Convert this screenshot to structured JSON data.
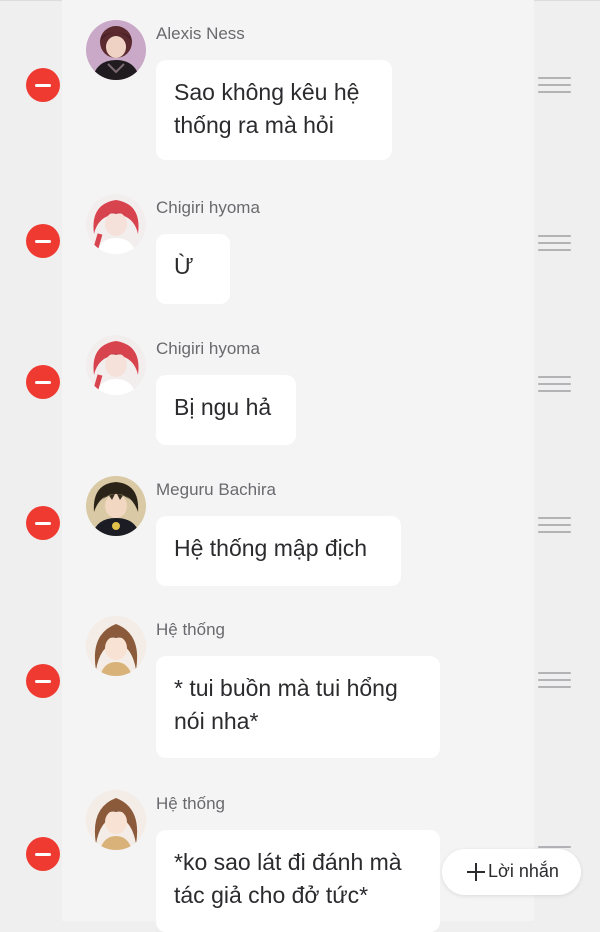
{
  "messages": [
    {
      "sender": "Alexis Ness",
      "avatar": "alexis-ness-avatar",
      "text": "Sao không kêu hệ thống ra mà hỏi"
    },
    {
      "sender": "Chigiri hyoma",
      "avatar": "chigiri-hyoma-avatar",
      "text": "Ừ"
    },
    {
      "sender": "Chigiri hyoma",
      "avatar": "chigiri-hyoma-avatar",
      "text": "Bị ngu hả"
    },
    {
      "sender": "Meguru Bachira",
      "avatar": "meguru-bachira-avatar",
      "text": "Hệ thống mập địch"
    },
    {
      "sender": "Hệ thống",
      "avatar": "he-thong-avatar",
      "text": "* tui buồn mà tui hổng nói nha*"
    },
    {
      "sender": "Hệ thống",
      "avatar": "he-thong-avatar",
      "text": "*ko sao lát đi đánh mà tác giả cho đở tức*"
    }
  ],
  "add_message_button": {
    "label": "Lời nhắn",
    "icon": "plus-icon"
  },
  "colors": {
    "delete": "#ef3a32",
    "background": "#efeff0",
    "panel": "#f4f4f5",
    "bubble": "#ffffff",
    "text": "#2b2b2e",
    "name": "#6a6a6e",
    "handle": "#b3b3b6"
  },
  "icons": {
    "delete": "minus-circle-icon",
    "reorder": "drag-handle-icon"
  }
}
